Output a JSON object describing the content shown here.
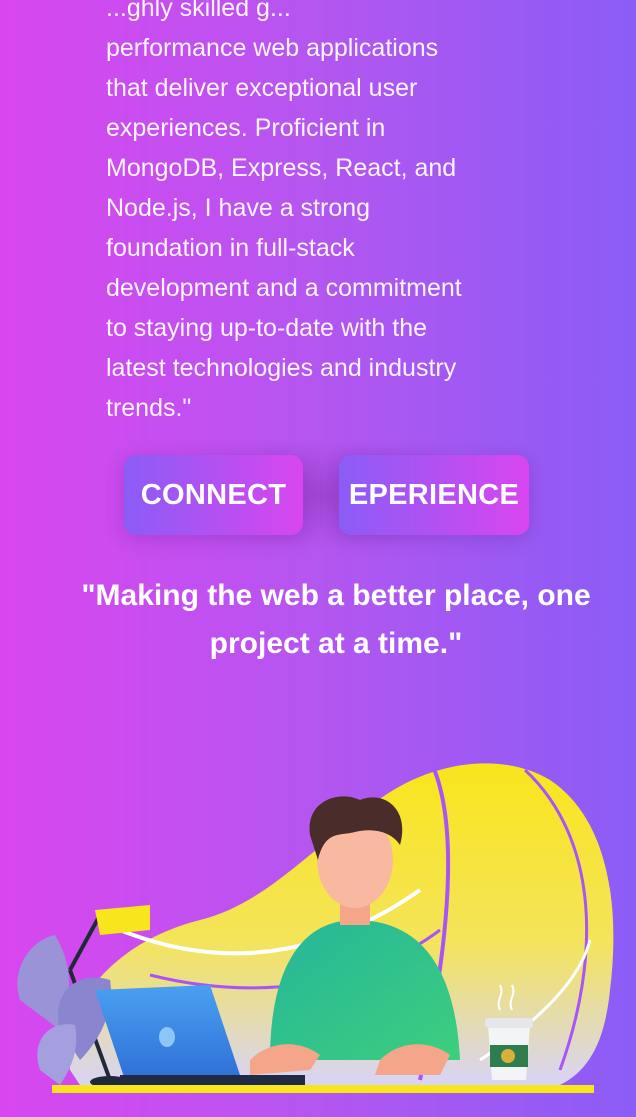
{
  "about": {
    "bio_lines": [
      "...ghly skilled g...",
      "performance web applications",
      "that deliver exceptional user",
      "experiences. Proficient in",
      "MongoDB, Express, React, and",
      "Node.js, I have a strong",
      "foundation in full-stack",
      "development and a commitment",
      "to staying up-to-date with the",
      "latest technologies and industry",
      "trends.\""
    ]
  },
  "actions": {
    "connect_label": "CONNECT",
    "experience_label": "EPERIENCE"
  },
  "tagline": {
    "line1": "\"Making the web a better place, one",
    "line2": "project at a time.\""
  },
  "illustration": {
    "icon": "developer-at-laptop-illustration"
  },
  "colors": {
    "gradient_start": "#d946ef",
    "gradient_end": "#8b5cf6",
    "blob_yellow": "#f7e733",
    "shirt_green": "#2bbf8a",
    "laptop_blue": "#3b82f6"
  }
}
